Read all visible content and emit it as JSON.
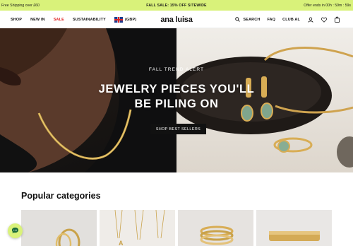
{
  "announcement": {
    "left": "Free Shipping over £60",
    "center": "FALL SALE: 15% OFF SITEWIDE",
    "right": "Offer ends in 00h : 59m : 59s"
  },
  "nav": {
    "links": [
      "SHOP",
      "NEW IN",
      "SALE",
      "SUSTAINABILITY"
    ],
    "currency": "(GBP)",
    "logo": "ana luisa",
    "search": "SEARCH",
    "faq": "FAQ",
    "club": "CLUB AL"
  },
  "hero": {
    "eyebrow": "FALL TREND ALERT",
    "headline_line1": "JEWELRY PIECES YOU'LL",
    "headline_line2": "BE PILING ON",
    "cta": "SHOP BEST SELLERS"
  },
  "categories": {
    "title": "Popular categories"
  },
  "colors": {
    "accent": "#d9f27a",
    "sale": "#e02020",
    "text": "#111111"
  },
  "icons": [
    "uk-flag-icon",
    "search-icon",
    "user-icon",
    "heart-icon",
    "bag-icon",
    "chat-icon"
  ]
}
